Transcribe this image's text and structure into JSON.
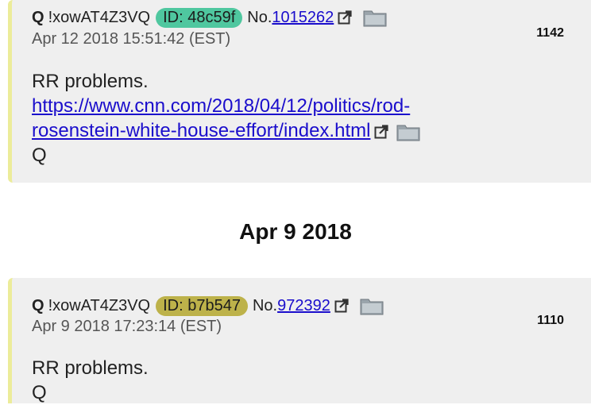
{
  "posts": [
    {
      "name": "Q",
      "tripcode": "!xowAT4Z3VQ",
      "id_label": "ID: 48c59f",
      "id_color": "#4fc79f",
      "no_label": "No.",
      "post_number": "1015262",
      "date": "Apr 12 2018 15:51:42 (EST)",
      "count": "1142",
      "body_line1": "RR problems.",
      "link_part1": "https://www.cnn.com/2018/04/12/politics/rod-",
      "link_part2": "rosenstein-white-house-effort/index.html",
      "signature": "Q"
    },
    {
      "name": "Q",
      "tripcode": "!xowAT4Z3VQ",
      "id_label": "ID: b7b547",
      "id_color": "#bdb24a",
      "no_label": "No.",
      "post_number": "972392",
      "date": "Apr 9 2018 17:23:14 (EST)",
      "count": "1110",
      "body_line1": "RR problems.",
      "signature": "Q"
    }
  ],
  "day_heading": "Apr 9 2018",
  "icons": {
    "external": "external-link-icon",
    "folder": "folder-icon"
  }
}
